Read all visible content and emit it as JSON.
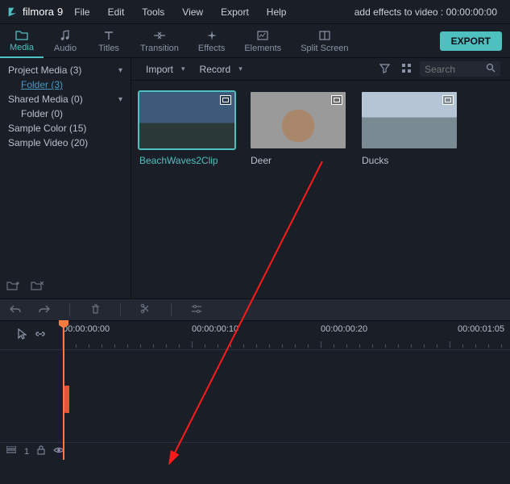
{
  "app": {
    "name": "filmora",
    "version": "9",
    "title": "add effects to video : 00:00:00:00"
  },
  "menu": {
    "file": "File",
    "edit": "Edit",
    "tools": "Tools",
    "view": "View",
    "export": "Export",
    "help": "Help"
  },
  "tabs": {
    "media": "Media",
    "audio": "Audio",
    "titles": "Titles",
    "transition": "Transition",
    "effects": "Effects",
    "elements": "Elements",
    "split": "Split Screen"
  },
  "export_btn": "EXPORT",
  "sidebar": {
    "project_media": "Project Media (3)",
    "folder_link": "Folder (3)",
    "shared_media": "Shared Media (0)",
    "folder": "Folder (0)",
    "sample_color": "Sample Color (15)",
    "sample_video": "Sample Video (20)"
  },
  "contentbar": {
    "import": "Import",
    "record": "Record",
    "search_placeholder": "Search"
  },
  "clips": [
    {
      "name": "BeachWaves2Clip",
      "selected": true,
      "thumb": "tx-waves"
    },
    {
      "name": "Deer",
      "selected": false,
      "thumb": "tx-deer"
    },
    {
      "name": "Ducks",
      "selected": false,
      "thumb": "tx-ducks"
    }
  ],
  "timeline": {
    "labels": [
      "00:00:00:00",
      "00:00:00:10",
      "00:00:00:20",
      "00:00:01:05"
    ],
    "footer_track": "1"
  }
}
